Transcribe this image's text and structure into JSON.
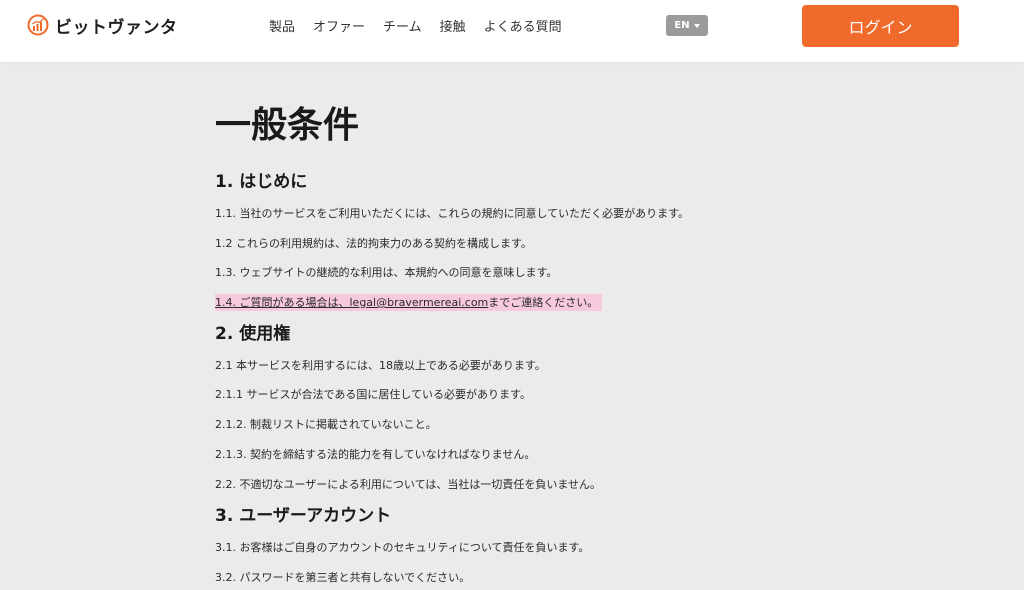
{
  "header": {
    "logo_text": "ビットヴァンタ",
    "nav": [
      "製品",
      "オファー",
      "チーム",
      "接触",
      "よくある質問"
    ],
    "lang": "EN",
    "login_label": "ログイン"
  },
  "colors": {
    "accent": "#f06a2c",
    "highlight": "#f6c9dd",
    "page_bg": "#ebebeb"
  },
  "main": {
    "title": "一般条件",
    "sections": [
      {
        "heading": "1. はじめに",
        "paragraphs": [
          "1.1. 当社のサービスをご利用いただくには、これらの規約に同意していただく必要があります。",
          "1.2 これらの利用規約は、法的拘束力のある契約を構成します。",
          "1.3. ウェブサイトの継続的な利用は、本規約への同意を意味します。"
        ],
        "highlight_prefix": "1.4. ご質問がある場合は、",
        "highlight_email": "legal@bravermereai.com",
        "highlight_suffix": "までご連絡ください。"
      },
      {
        "heading": "2. 使用権",
        "paragraphs": [
          "2.1 本サービスを利用するには、18歳以上である必要があります。",
          "2.1.1 サービスが合法である国に居住している必要があります。",
          "2.1.2. 制裁リストに掲載されていないこと。",
          "2.1.3. 契約を締結する法的能力を有していなければなりません。",
          "2.2. 不適切なユーザーによる利用については、当社は一切責任を負いません。"
        ]
      },
      {
        "heading": "3. ユーザーアカウント",
        "paragraphs": [
          "3.1. お客様はご自身のアカウントのセキュリティについて責任を負います。",
          "3.2. パスワードを第三者と共有しないでください。"
        ]
      }
    ]
  }
}
